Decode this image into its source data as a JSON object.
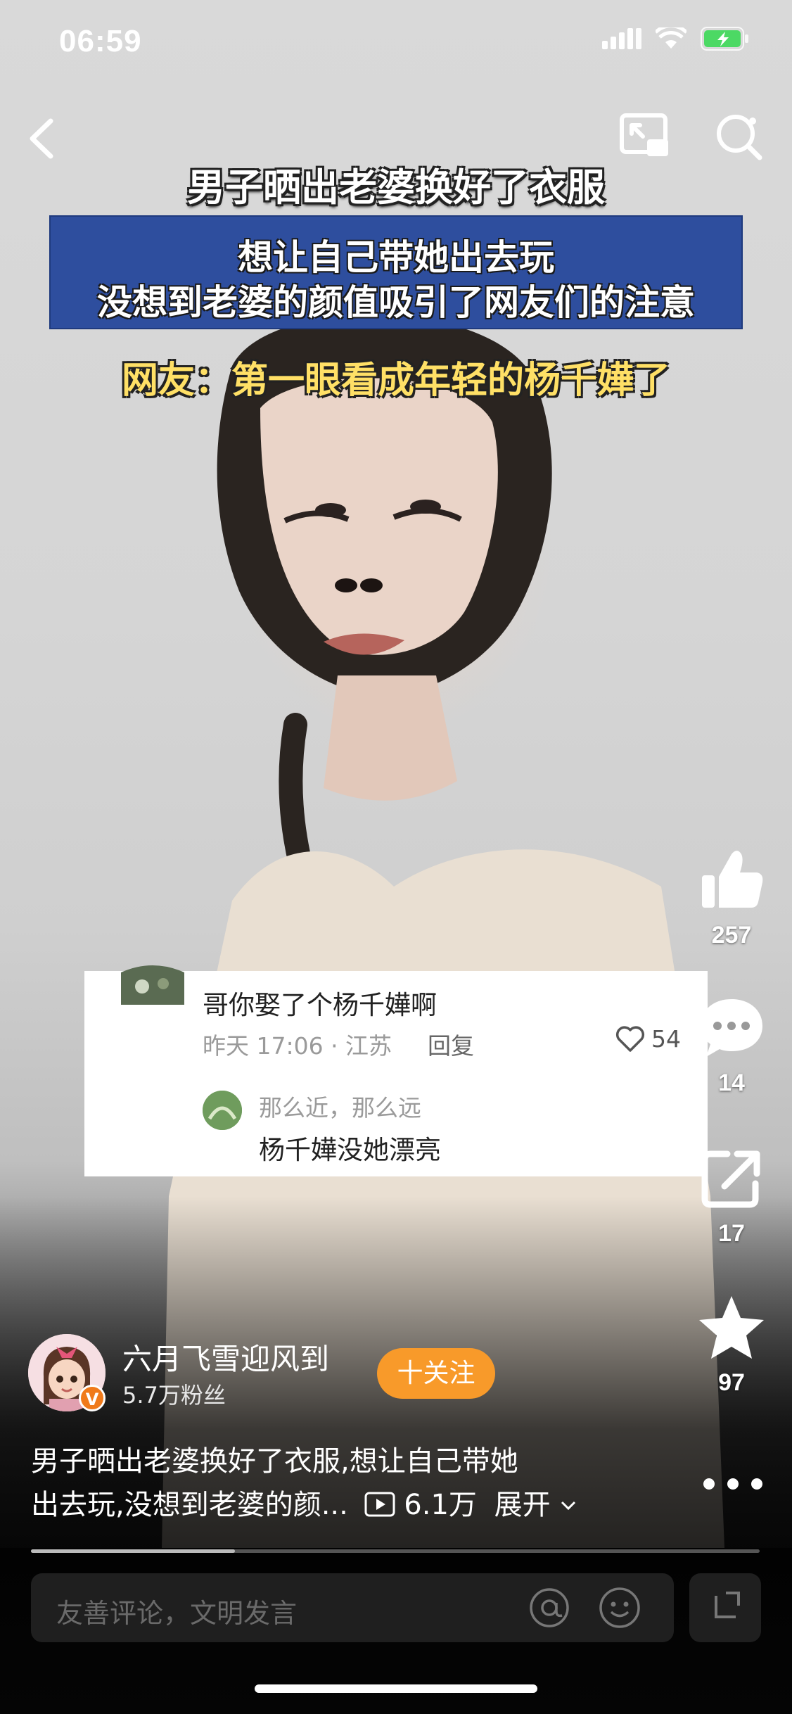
{
  "status_bar": {
    "time": "06:59"
  },
  "video_captions": {
    "headline": "男子晒出老婆换好了衣服",
    "box_line1": "想让自己带她出去玩",
    "box_line2": "没想到老婆的颜值吸引了网友们的注意",
    "netizen": "网友：第一眼看成年轻的杨千嬅了"
  },
  "actions": {
    "likes": "257",
    "comments": "14",
    "shares": "17",
    "favorites": "97"
  },
  "pinned_comment": {
    "text": "哥你娶了个杨千嬅啊",
    "meta": "昨天 17:06 · 江苏",
    "reply_label": "回复",
    "like_count": "54",
    "reply": {
      "name": "那么近，那么远",
      "text": "杨千嬅没她漂亮"
    }
  },
  "author": {
    "name": "六月飞雪迎风到",
    "fans": "5.7万粉丝",
    "follow_label": "十关注",
    "badge": "V"
  },
  "description": {
    "line1": "男子晒出老婆换好了衣服,想让自己带她",
    "line2": "出去玩,没想到老婆的颜...",
    "plays": "6.1万",
    "expand": "展开"
  },
  "playback": {
    "progress_fraction": 0.28
  },
  "comment_input": {
    "placeholder": "友善评论，文明发言"
  },
  "colors": {
    "follow_button": "#f89a2a",
    "caption_box": "#2e4e9e",
    "caption_highlight": "#ffe066",
    "battery": "#4cd964"
  }
}
